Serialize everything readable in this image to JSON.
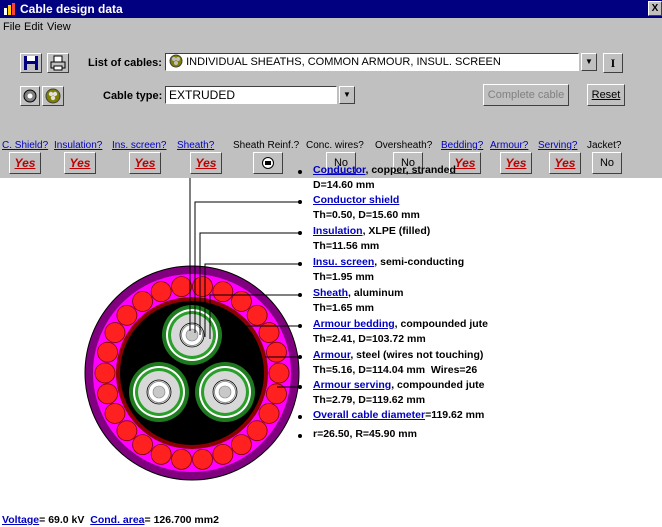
{
  "window": {
    "title": "Cable design data",
    "close_glyph": "X"
  },
  "menu": {
    "file": "File",
    "edit": "Edit",
    "view": "View"
  },
  "toolbar": {
    "list_label": "List of cables:",
    "list_value": "INDIVIDUAL SHEATHS, COMMON ARMOUR, INSUL. SCREEN",
    "info_button": "I",
    "cable_type_label": "Cable type:",
    "cable_type_value": "EXTRUDED",
    "complete_cable": "Complete cable",
    "reset": "Reset"
  },
  "options": [
    {
      "header": "C. Shield?",
      "value": "Yes",
      "link": true
    },
    {
      "header": "Insulation?",
      "value": "Yes",
      "link": true
    },
    {
      "header": "Ins. screen?",
      "value": "Yes",
      "link": true
    },
    {
      "header": "Sheath?",
      "value": "Yes",
      "link": true
    },
    {
      "header": "Sheath Reinf.?",
      "value": "",
      "link": false
    },
    {
      "header": "Conc. wires?",
      "value": "No",
      "link": false
    },
    {
      "header": "Oversheath?",
      "value": "No",
      "link": false
    },
    {
      "header": "Bedding?",
      "value": "Yes",
      "link": true
    },
    {
      "header": "Armour?",
      "value": "Yes",
      "link": true
    },
    {
      "header": "Serving?",
      "value": "Yes",
      "link": true
    },
    {
      "header": "Jacket?",
      "value": "No",
      "link": false
    }
  ],
  "annotations": {
    "conductor": {
      "link": "Conductor",
      "text": ", copper, stranded",
      "line2": "D=14.60 mm"
    },
    "conductor_shield": {
      "link": "Conductor shield",
      "line2": "Th=0.50, D=15.60 mm"
    },
    "insulation": {
      "link": "Insulation",
      "text": ", XLPE (filled)",
      "line2": "Th=11.56 mm"
    },
    "insu_screen": {
      "link": "Insu. screen",
      "text": ", semi-conducting",
      "line2": "Th=1.95 mm"
    },
    "sheath": {
      "link": "Sheath",
      "text": ", aluminum",
      "line2": "Th=1.65 mm"
    },
    "armour_bedding": {
      "link": "Armour bedding",
      "text": ", compounded jute",
      "line2": "Th=2.41, D=103.72 mm"
    },
    "armour": {
      "link": "Armour",
      "text": ", steel (wires not touching)",
      "line2": "Th=5.16, D=114.04 mm  Wires=26"
    },
    "armour_serving": {
      "link": "Armour serving",
      "text": ", compounded jute",
      "line2": "Th=2.79, D=119.62 mm"
    },
    "overall": {
      "link": "Overall cable diameter",
      "text": "=119.62 mm"
    },
    "radii": {
      "text": "r=26.50, R=45.90 mm"
    }
  },
  "footer": {
    "voltage_link": "Voltage",
    "voltage_value": "= 69.0 kV",
    "area_link": "Cond. area",
    "area_value": "= 126.700 mm2"
  },
  "colors": {
    "title_bar": "#000080",
    "link": "#0000c0",
    "yes": "#c00000",
    "serving": "#800080",
    "armour_wire": "#ff2020"
  }
}
